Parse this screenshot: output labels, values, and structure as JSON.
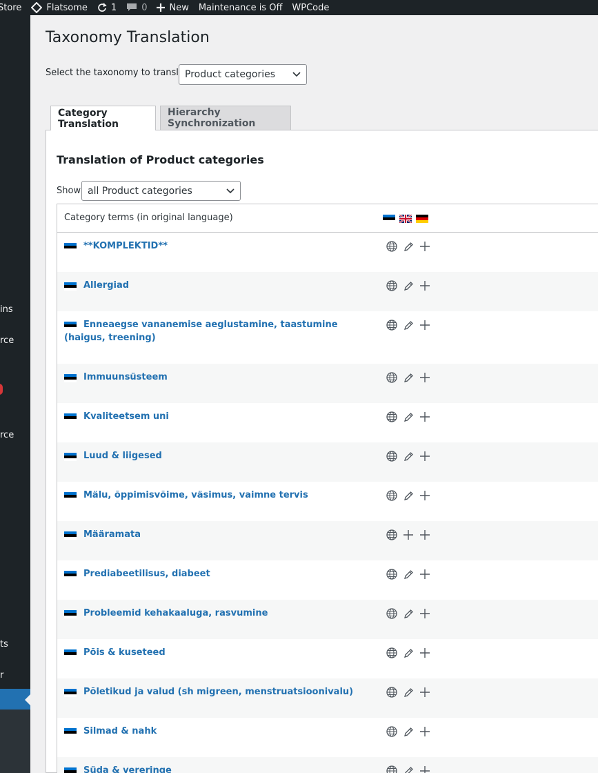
{
  "admin_bar": {
    "store_label": "Store",
    "theme_label": "Flatsome",
    "updates_count": "1",
    "comments_count": "0",
    "new_label": "New",
    "maintenance_label": "Maintenance is Off",
    "wpcode_label": "WPCode"
  },
  "sidebar": {
    "items": [
      "ins",
      "rce",
      "rce",
      "ts",
      "r"
    ]
  },
  "page": {
    "title": "Taxonomy Translation",
    "taxonomy_label": "Select the taxonomy to translate:",
    "taxonomy_selected": "Product categories"
  },
  "tabs": [
    {
      "label": "Category Translation",
      "active": true
    },
    {
      "label": "Hierarchy Synchronization",
      "active": false
    }
  ],
  "panel": {
    "title": "Translation of Product categories",
    "show_label": "Show",
    "filter_selected": "all Product categories"
  },
  "table": {
    "header": "Category terms (in original language)",
    "languages": [
      "et",
      "en",
      "de"
    ],
    "rows": [
      {
        "name": "**KOMPLEKTID**",
        "en": "edit",
        "de": "add"
      },
      {
        "name": "Allergiad",
        "en": "edit",
        "de": "add"
      },
      {
        "name": "Enneaegse vananemise aeglustamine, taastumine (haigus, treening)",
        "en": "edit",
        "de": "add"
      },
      {
        "name": "Immuunsüsteem",
        "en": "edit",
        "de": "add"
      },
      {
        "name": "Kvaliteetsem uni",
        "en": "edit",
        "de": "add"
      },
      {
        "name": "Luud & liigesed",
        "en": "edit",
        "de": "add"
      },
      {
        "name": "Mälu, õppimisvõime, väsimus, vaimne tervis",
        "en": "edit",
        "de": "add"
      },
      {
        "name": "Määramata",
        "en": "add",
        "de": "add"
      },
      {
        "name": "Prediabeetilisus, diabeet",
        "en": "edit",
        "de": "add"
      },
      {
        "name": "Probleemid kehakaaluga, rasvumine",
        "en": "edit",
        "de": "add"
      },
      {
        "name": "Põis & kuseteed",
        "en": "edit",
        "de": "add"
      },
      {
        "name": "Põletikud ja valud (sh migreen, menstruatsioonivalu)",
        "en": "edit",
        "de": "add"
      },
      {
        "name": "Silmad & nahk",
        "en": "edit",
        "de": "add"
      },
      {
        "name": "Süda & vereringe",
        "en": "edit",
        "de": "add"
      }
    ]
  },
  "colors": {
    "admin_bar": "#1d2327",
    "link": "#2271b1",
    "active_menu": "#2271b1"
  }
}
